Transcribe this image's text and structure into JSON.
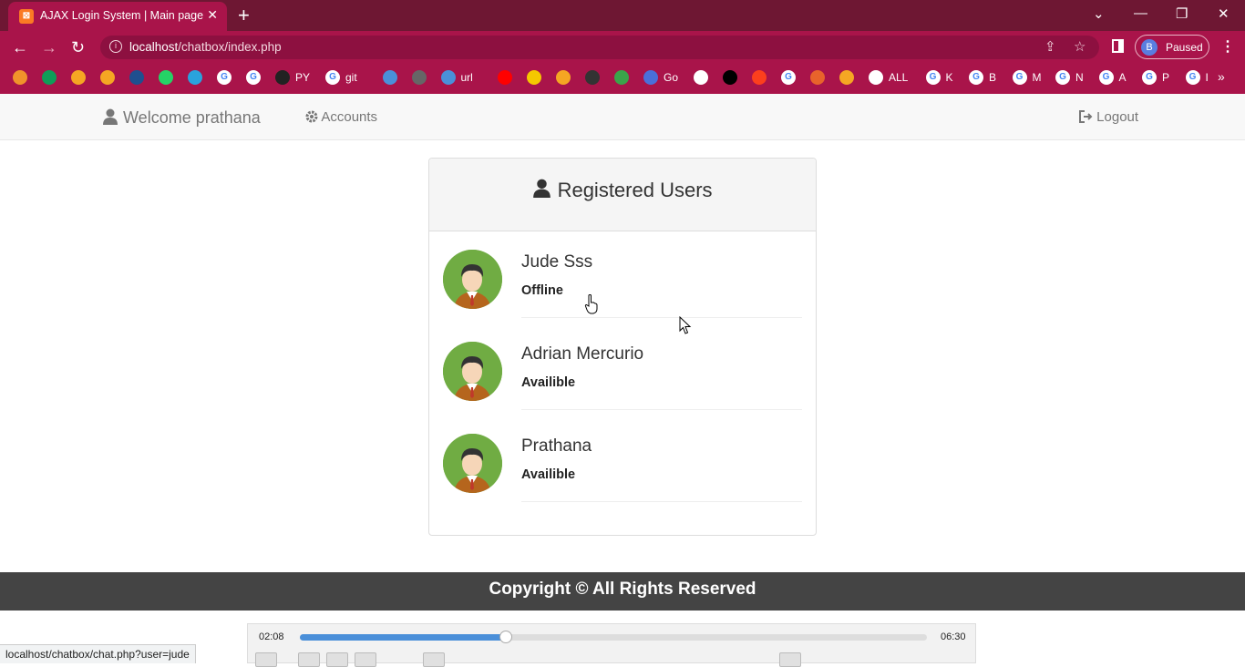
{
  "browser": {
    "tab_title": "AJAX Login System | Main page",
    "tab_close": "✕",
    "new_tab": "+",
    "url_host": "localhost",
    "url_path": "/chatbox/index.php",
    "profile_initial": "B",
    "profile_status": "Paused",
    "status_url": "localhost/chatbox/chat.php?user=jude",
    "bookmarks": [
      {
        "label": "",
        "icon": "bookmark-icon",
        "color": "#f0932b"
      },
      {
        "label": "",
        "icon": "plus-tile-icon",
        "color": "#0f9d58"
      },
      {
        "label": "",
        "icon": "bookmark-icon",
        "color": "#f5a623"
      },
      {
        "label": "",
        "icon": "bar-chart-icon",
        "color": "#f5a623"
      },
      {
        "label": "",
        "icon": "ieee-icon",
        "color": "#1f4f8f"
      },
      {
        "label": "",
        "icon": "whatsapp-icon",
        "color": "#25d366"
      },
      {
        "label": "",
        "icon": "telegram-icon",
        "color": "#2aa3dd"
      },
      {
        "label": "",
        "icon": "google-icon",
        "color": "#ffffff"
      },
      {
        "label": "",
        "icon": "google-icon",
        "color": "#ffffff"
      },
      {
        "label": "PY",
        "icon": "github-icon",
        "color": "#222222"
      },
      {
        "label": "git",
        "icon": "google-icon",
        "color": "#ffffff"
      },
      {
        "label": "",
        "icon": "bookmark-icon",
        "color": "#4a90d9"
      },
      {
        "label": "",
        "icon": "store-icon",
        "color": "#666666"
      },
      {
        "label": "url",
        "icon": "cloud-icon",
        "color": "#4a90d9"
      },
      {
        "label": "",
        "icon": "youtube-icon",
        "color": "#ff0000"
      },
      {
        "label": "",
        "icon": "p-icon",
        "color": "#f5c800"
      },
      {
        "label": "",
        "icon": "bookmark-icon",
        "color": "#f5a623"
      },
      {
        "label": "",
        "icon": "bookmark-icon",
        "color": "#333333"
      },
      {
        "label": "",
        "icon": "ring-icon",
        "color": "#3aa34a"
      },
      {
        "label": "Go",
        "icon": "heart-icon",
        "color": "#4a6fd9"
      },
      {
        "label": "",
        "icon": "bookmark-icon",
        "color": "#ffffff"
      },
      {
        "label": "",
        "icon": "ci-icon",
        "color": "#000000"
      },
      {
        "label": "",
        "icon": "yandex-icon",
        "color": "#fc3f1d"
      },
      {
        "label": "",
        "icon": "google-icon",
        "color": "#ffffff"
      },
      {
        "label": "",
        "icon": "bookmark-icon",
        "color": "#e8632b"
      },
      {
        "label": "",
        "icon": "bookmark-icon",
        "color": "#f5a623"
      },
      {
        "label": "ALL",
        "icon": "globe-icon",
        "color": "#ffffff"
      },
      {
        "label": "K",
        "icon": "google-icon",
        "color": "#ffffff"
      },
      {
        "label": "B",
        "icon": "google-icon",
        "color": "#ffffff"
      },
      {
        "label": "M",
        "icon": "google-icon",
        "color": "#ffffff"
      },
      {
        "label": "N",
        "icon": "google-icon",
        "color": "#ffffff"
      },
      {
        "label": "A",
        "icon": "google-icon",
        "color": "#ffffff"
      },
      {
        "label": "P",
        "icon": "google-icon",
        "color": "#ffffff"
      },
      {
        "label": "I",
        "icon": "google-icon",
        "color": "#ffffff"
      }
    ],
    "bookmarks_more": "»"
  },
  "app": {
    "welcome": "Welcome prathana",
    "accounts": "Accounts",
    "logout": "Logout",
    "panel_title": "Registered Users",
    "users": [
      {
        "name": "Jude Sss",
        "status": "Offline"
      },
      {
        "name": "Adrian Mercurio",
        "status": "Availible"
      },
      {
        "name": "Prathana",
        "status": "Availible"
      }
    ],
    "footer": "Copyright © All Rights Reserved"
  },
  "player": {
    "elapsed": "02:08",
    "duration": "06:30",
    "progress": 0.329
  },
  "colors": {
    "titlebar": "#6e1733",
    "toolbar": "#a9144a",
    "avatar_bg": "#70ac43",
    "footer_bg": "#444444",
    "seek_fill": "#4a8fd9"
  }
}
